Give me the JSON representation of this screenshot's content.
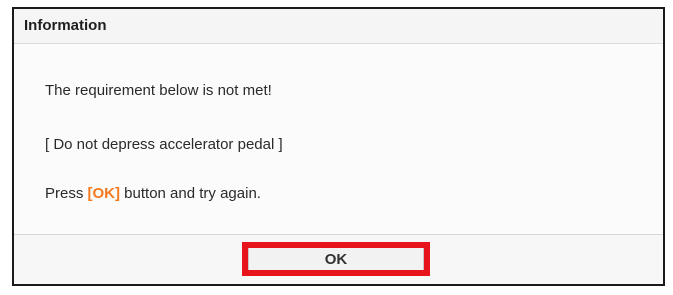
{
  "dialog": {
    "title": "Information",
    "message_line1": "The requirement below is not met!",
    "message_line2": "[ Do not depress accelerator pedal ]",
    "message_line3_prefix": "Press ",
    "message_line3_highlight": "[OK]",
    "message_line3_suffix": " button and try again.",
    "ok_label": "OK"
  },
  "colors": {
    "highlight": "#f47a20",
    "ok_outline": "#e8141c"
  }
}
